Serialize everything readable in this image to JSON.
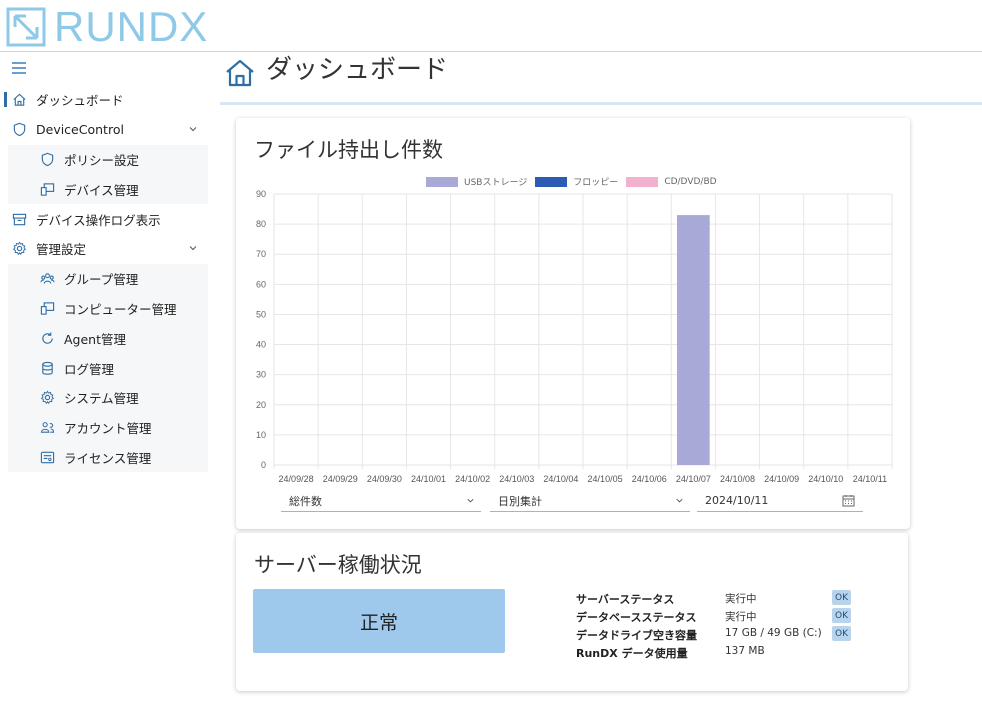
{
  "app": {
    "logo_text": "RUNDX"
  },
  "sidebar": {
    "items": [
      {
        "label": "ダッシュボード",
        "icon": "home-icon",
        "level": "top",
        "active": true
      },
      {
        "label": "DeviceControl",
        "icon": "shield-icon",
        "level": "top",
        "expandable": true
      },
      {
        "label": "ポリシー設定",
        "icon": "shield-icon",
        "level": "sub"
      },
      {
        "label": "デバイス管理",
        "icon": "device-icon",
        "level": "sub"
      },
      {
        "label": "デバイス操作ログ表示",
        "icon": "archive-icon",
        "level": "top"
      },
      {
        "label": "管理設定",
        "icon": "gear-icon",
        "level": "top",
        "expandable": true
      },
      {
        "label": "グループ管理",
        "icon": "group-icon",
        "level": "sub"
      },
      {
        "label": "コンピューター管理",
        "icon": "computer-icon",
        "level": "sub"
      },
      {
        "label": "Agent管理",
        "icon": "refresh-icon",
        "level": "sub"
      },
      {
        "label": "ログ管理",
        "icon": "database-icon",
        "level": "sub"
      },
      {
        "label": "システム管理",
        "icon": "gear-icon",
        "level": "sub"
      },
      {
        "label": "アカウント管理",
        "icon": "users-icon",
        "level": "sub"
      },
      {
        "label": "ライセンス管理",
        "icon": "license-icon",
        "level": "sub"
      }
    ]
  },
  "page": {
    "title": "ダッシュボード"
  },
  "file_card": {
    "title": "ファイル持出し件数",
    "select_total": "総件数",
    "select_period": "日別集計",
    "date_value": "2024/10/11"
  },
  "chart_data": {
    "type": "bar",
    "categories": [
      "24/09/28",
      "24/09/29",
      "24/09/30",
      "24/10/01",
      "24/10/02",
      "24/10/03",
      "24/10/04",
      "24/10/05",
      "24/10/06",
      "24/10/07",
      "24/10/08",
      "24/10/09",
      "24/10/10",
      "24/10/11"
    ],
    "series": [
      {
        "name": "USBストレージ",
        "color": "#a9a9d8",
        "values": [
          0,
          0,
          0,
          0,
          0,
          0,
          0,
          0,
          0,
          83,
          0,
          0,
          0,
          0
        ]
      },
      {
        "name": "フロッピー",
        "color": "#2b5bb5",
        "values": [
          0,
          0,
          0,
          0,
          0,
          0,
          0,
          0,
          0,
          0,
          0,
          0,
          0,
          0
        ]
      },
      {
        "name": "CD/DVD/BD",
        "color": "#f2b2cf",
        "values": [
          0,
          0,
          0,
          0,
          0,
          0,
          0,
          0,
          0,
          0,
          0,
          0,
          0,
          0
        ]
      }
    ],
    "ylim": [
      0,
      90
    ],
    "yticks": [
      0,
      10,
      20,
      30,
      40,
      50,
      60,
      70,
      80,
      90
    ],
    "grid": true,
    "legend": "top"
  },
  "server_card": {
    "title": "サーバー稼働状況",
    "status": "正常",
    "rows": [
      {
        "label": "サーバーステータス",
        "value": "実行中",
        "badge": "OK"
      },
      {
        "label": "データベースステータス",
        "value": "実行中",
        "badge": "OK"
      },
      {
        "label": "データドライブ空き容量",
        "value": "17 GB / 49 GB (C:)",
        "badge": "OK"
      },
      {
        "label": "RunDX データ使用量",
        "value": "137 MB",
        "badge": ""
      }
    ]
  }
}
